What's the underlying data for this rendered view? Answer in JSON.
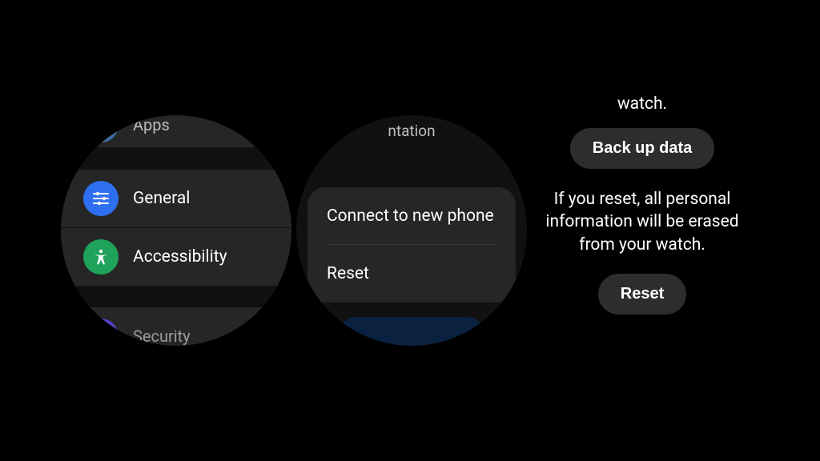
{
  "screen1": {
    "items": {
      "apps": {
        "label": "Apps"
      },
      "general": {
        "label": "General"
      },
      "accessibility": {
        "label": "Accessibility"
      },
      "security": {
        "label": "Security"
      }
    }
  },
  "screen2": {
    "top_fragment": "ntation",
    "options": {
      "connect": {
        "label": "Connect to new phone"
      },
      "reset": {
        "label": "Reset"
      }
    }
  },
  "screen3": {
    "line_above_backup": "watch.",
    "backup_button": "Back up data",
    "warning_text": "If you reset, all personal information will be erased from your watch.",
    "reset_button": "Reset"
  }
}
